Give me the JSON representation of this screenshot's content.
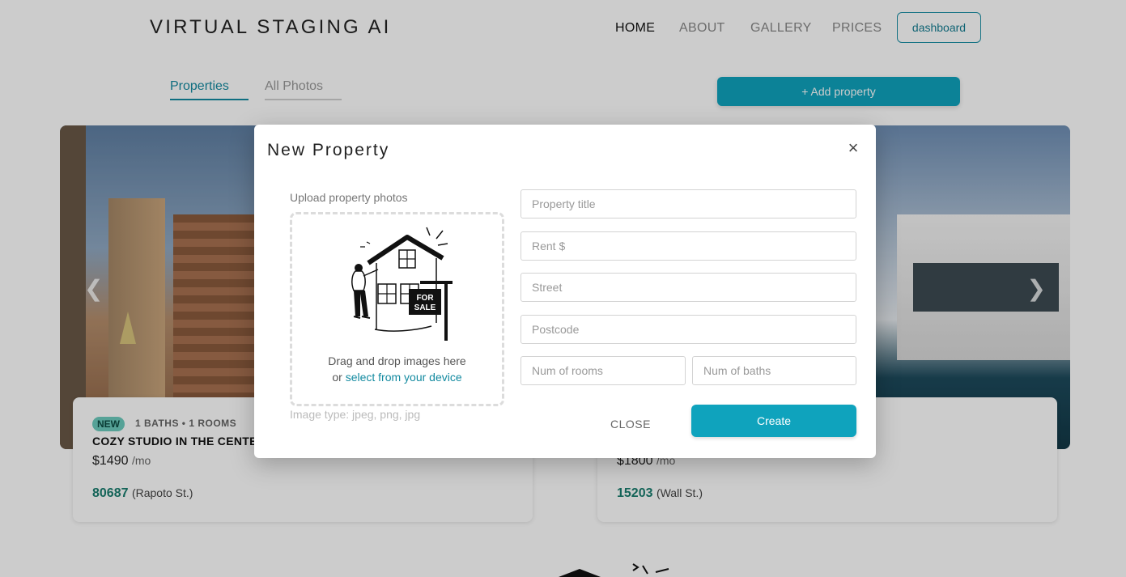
{
  "header": {
    "brand": "VIRTUAL STAGING AI",
    "nav": [
      "HOME",
      "ABOUT",
      "GALLERY",
      "PRICES"
    ],
    "dashboard_label": "dashboard"
  },
  "tabs": {
    "properties": "Properties",
    "all_photos": "All Photos"
  },
  "add_property_label": "+ Add property",
  "carousel": {
    "prev_icon": "chevron-left-icon",
    "next_icon": "chevron-right-icon"
  },
  "cards": [
    {
      "badge": "NEW",
      "meta": "1 BATHS • 1 ROOMS",
      "title": "COZY STUDIO IN THE CENTER",
      "price": "$1490",
      "per": "/mo",
      "zip": "80687",
      "street": "(Rapoto St.)"
    },
    {
      "price": "$1800",
      "per": "/mo",
      "zip": "15203",
      "street": "(Wall St.)"
    }
  ],
  "modal": {
    "title": "New Property",
    "close_icon": "×",
    "upload_label": "Upload property photos",
    "drop_text": "Drag and drop images here",
    "drop_or": "or",
    "drop_link": "select from your device",
    "illustration_sign": [
      "FOR",
      "SALE"
    ],
    "image_types": "Image type: jpeg, png, jpg",
    "fields": {
      "title": "Property title",
      "rent": "Rent $",
      "street": "Street",
      "postcode": "Postcode",
      "rooms": "Num of rooms",
      "baths": "Num of baths"
    },
    "close_label": "CLOSE",
    "create_label": "Create"
  },
  "colors": {
    "accent": "#0fa3bd",
    "accent_text": "#138aa0",
    "badge": "#6ccbbd"
  }
}
